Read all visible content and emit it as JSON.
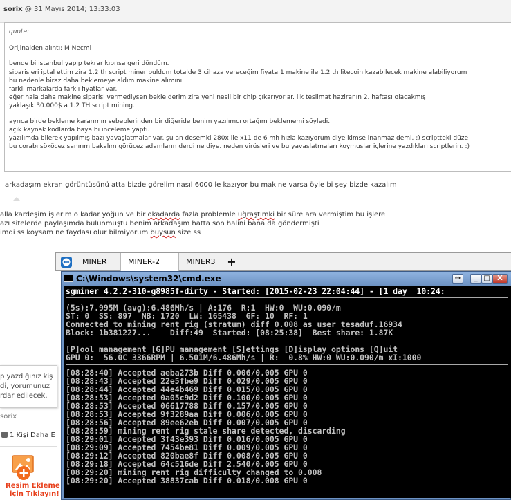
{
  "post": {
    "author": "sorix",
    "date": " @ 31 Mayıs 2014; 13:33:03",
    "quote_label": "quote:",
    "quote_lines": [
      "Orijinalden alıntı: M Necmi",
      "",
      "bende bi istanbul yapıp tekrar kıbrısa geri döndüm.",
      "siparişleri iptal ettim zira 1.2 th script miner buldum totalde 3 cihaza vereceğim fiyata 1 makine ile 1.2 th litecoin kazabilecek makine alabiliyorum",
      "bu nedenle biraz daha beklemeye aldım makine alımını.",
      "farklı markalarda farklı fiyatlar var.",
      "eğer hala daha makine siparişi vermediysen bekle derim zira yeni nesil bir chip çıkarıyorlar. ilk teslimat haziranın 2. haftası olacakmış",
      "yaklaşık 30.000$ a 1.2 TH script mining.",
      "",
      "ayrıca birde bekleme kararımın sebeplerinden bir diğeride benim yazılımcı ortağım beklememi söyledi.",
      "açık kaynak kodlarda baya bi inceleme yaptı.",
      "yazılımda bilerek yapılmış bazı yavaşlatmalar var. şu an desemki 280x ile x11 de 6 mh hızla kazıyorum diye kimse inanmaz demi. :) scriptteki düze",
      "bu çorabı sököcez sanırım bakalım görücez adamların derdi ne diye. neden virüsleri ve bu yavaşlatmaları koymuşlar içlerine yazdıkları scriptlerin. :)"
    ],
    "after_quote": "arkadaşım ekran görüntüsünü atta bizde görelim nasıl 6000 le kazıyor bu makine varsa öyle bi şey bizde kazalım"
  },
  "reply": {
    "line1_a": "alla kardeşim işlerim o kadar yoğun ve bir ",
    "line1_b": "okadarda",
    "line1_c": " fazla problemle ",
    "line1_d": "uğraştımki",
    "line1_e": " bir süre ara vermiştim bu işlere",
    "line2": "azı sitelerde paylaşımda bulunmuştu benim arkadaşım hatta son halini bana da göndermişti",
    "line3_a": "imdi ss koysam ne faydası olur bilmiyorum ",
    "line3_b": "buysun",
    "line3_c": " size ss"
  },
  "left_widget": {
    "popup_lines": [
      "p yazdığınız kiş",
      "di, yorumunuz",
      "rdar edilecek."
    ],
    "user": "sorix",
    "like_text": "1 Kişi Daha E",
    "upload_line1": "Resim Ekleme",
    "upload_line2": "için Tıklayın!"
  },
  "tabs": [
    {
      "label": "MINER",
      "active": false
    },
    {
      "label": "MINER-2",
      "active": true
    },
    {
      "label": "MINER3",
      "active": false
    }
  ],
  "tab_add": "+",
  "console": {
    "title": "C:\\Windows\\system32\\cmd.exe",
    "btn_resize": "↔",
    "btn_min": "_",
    "btn_max": "□",
    "btn_close": "X",
    "header": "sgminer 4.2.2-310-g8985f-dirty - Started: [2015-02-23 22:04:44] - [1 day  10:24:",
    "stats": [
      "(5s):7.995M (avg):6.486Mh/s | A:176  R:1  HW:0  WU:0.090/m",
      "ST: 0  SS: 897  NB: 1720  LW: 165438  GF: 10  RF: 1",
      "Connected to mining rent rig (stratum) diff 0.008 as user tesaduf.16934",
      "Block: 1b381227...    Diff:49  Started: [08:25:38]  Best share: 1.87K"
    ],
    "menu": "[P]ool management [G]PU management [S]ettings [D]isplay options [Q]uit",
    "gpu": "GPU 0:  56.0C 3366RPM | 6.501M/6.486Mh/s | R:  0.8% HW:0 WU:0.090/m xI:1000",
    "log": [
      "[08:28:40] Accepted aeba273b Diff 0.006/0.005 GPU 0",
      "[08:28:43] Accepted 22e5fbe9 Diff 0.029/0.005 GPU 0",
      "[08:28:44] Accepted 44e4b469 Diff 0.015/0.005 GPU 0",
      "[08:28:53] Accepted 0a05c9d2 Diff 0.100/0.005 GPU 0",
      "[08:28:53] Accepted 06617788 Diff 0.157/0.005 GPU 0",
      "[08:28:53] Accepted 9f3289aa Diff 0.006/0.005 GPU 0",
      "[08:28:56] Accepted 89ee62eb Diff 0.007/0.005 GPU 0",
      "[08:28:59] mining rent rig stale share detected, discarding",
      "[08:29:01] Accepted 3f43e393 Diff 0.016/0.005 GPU 0",
      "[08:29:09] Accepted 7454be81 Diff 0.009/0.005 GPU 0",
      "[08:29:12] Accepted 820bae8f Diff 0.008/0.005 GPU 0",
      "[08:29:18] Accepted 64c516de Diff 2.540/0.005 GPU 0",
      "[08:29:20] mining rent rig difficulty changed to 0.008",
      "[08:29:20] Accepted 38837cab Diff 0.018/0.008 GPU 0"
    ]
  },
  "colors": {
    "console_bg": "#000000",
    "console_text": "#c0c0c0",
    "titlebar": "#6d93c4",
    "upload_accent": "#e8401c"
  }
}
